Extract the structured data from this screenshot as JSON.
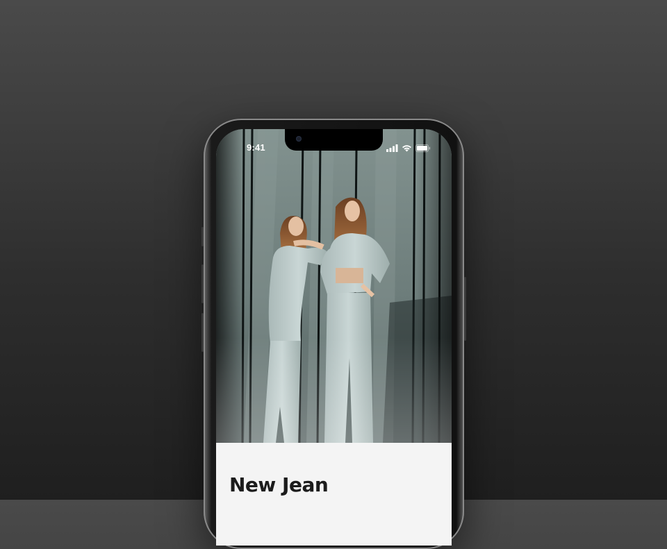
{
  "status_bar": {
    "time": "9:41",
    "icons": [
      "cellular-signal-icon",
      "wifi-icon",
      "battery-icon"
    ]
  },
  "hero": {
    "image": "photo-two-women-in-pale-mint-suits"
  },
  "product": {
    "title": "New Jean"
  },
  "colors": {
    "backdrop": "#3a3a3a",
    "card_background": "#f4f4f4",
    "title_text": "#1c1c1c"
  }
}
